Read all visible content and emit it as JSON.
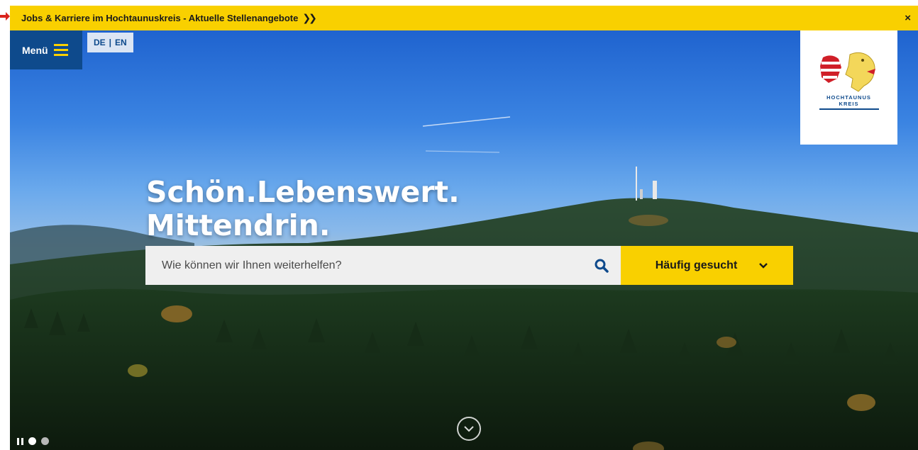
{
  "banner": {
    "text": "Jobs & Karriere im Hochtaunuskreis - Aktuelle Stellenangebote",
    "chevrons_icon": "double-chevron-right-icon",
    "close_label": "×",
    "background": "#f9d000"
  },
  "header": {
    "menu_label": "Menü",
    "menu_icon": "hamburger-icon",
    "languages": [
      "DE",
      "EN"
    ],
    "lang_separator": "|"
  },
  "logo": {
    "line1": "HOCHTAUNUS",
    "line2": "KREIS",
    "icon": "hochtaunuskreis-coat-of-arms-icon"
  },
  "hero": {
    "headline_line1": "Schön.Lebenswert.",
    "headline_line2": "Mittendrin.",
    "search_placeholder": "Wie können wir Ihnen weiterhelfen?",
    "search_icon": "search-icon",
    "frequent_label": "Häufig gesucht",
    "frequent_icon": "chevron-down-icon",
    "scroll_icon": "chevron-down-circle-icon"
  },
  "slider": {
    "pause_icon": "pause-icon",
    "dots": 2,
    "active_index": 0
  },
  "colors": {
    "brand_blue": "#0e4a8c",
    "accent_yellow": "#f9d000"
  }
}
